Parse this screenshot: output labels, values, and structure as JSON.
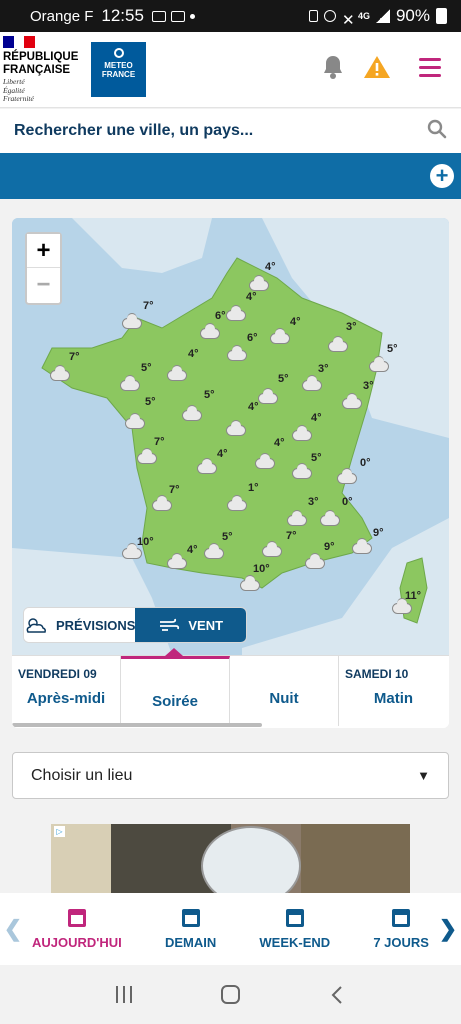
{
  "status_bar": {
    "carrier": "Orange F",
    "time": "12:55",
    "network": "4G",
    "battery": "90%"
  },
  "header": {
    "gov_title_line1": "RÉPUBLIQUE",
    "gov_title_line2": "FRANÇAISE",
    "gov_motto_1": "Liberté",
    "gov_motto_2": "Égalité",
    "gov_motto_3": "Fraternité",
    "brand_line1": "METEO",
    "brand_line2": "FRANCE"
  },
  "search": {
    "placeholder": "Rechercher une ville, un pays..."
  },
  "map": {
    "zoom_in": "+",
    "zoom_out": "−",
    "temperatures": [
      "4°",
      "4°",
      "6°",
      "7°",
      "6°",
      "4°",
      "3°",
      "5°",
      "7°",
      "5°",
      "4°",
      "3°",
      "5°",
      "5°",
      "5°",
      "4°",
      "3°",
      "7°",
      "4°",
      "4°",
      "7°",
      "1°",
      "5°",
      "0°",
      "4°",
      "3°",
      "0°",
      "7°",
      "10°",
      "4°",
      "5°",
      "9°",
      "9°",
      "10°",
      "11°"
    ],
    "toggle": {
      "forecast_label": "PRÉVISIONS",
      "wind_label": "VENT"
    },
    "slots": [
      {
        "day": "VENDREDI 09",
        "period": "Après-midi"
      },
      {
        "day": "",
        "period": "Soirée"
      },
      {
        "day": "",
        "period": "Nuit"
      },
      {
        "day": "SAMEDI 10",
        "period": "Matin"
      }
    ]
  },
  "location_select": {
    "label": "Choisir un lieu"
  },
  "bottom_nav": {
    "items": [
      {
        "label": "AUJOURD'HUI",
        "icon": "calendar-check-icon"
      },
      {
        "label": "DEMAIN",
        "icon": "calendar-icon"
      },
      {
        "label": "WEEK-END",
        "icon": "calendar-icon"
      },
      {
        "label": "7 JOURS",
        "icon": "calendar-grid-icon"
      }
    ]
  },
  "colors": {
    "brand_blue": "#0f6da6",
    "accent_pink": "#c0267c",
    "land_green": "#8cc760",
    "sea_blue": "#b7d4e8"
  }
}
